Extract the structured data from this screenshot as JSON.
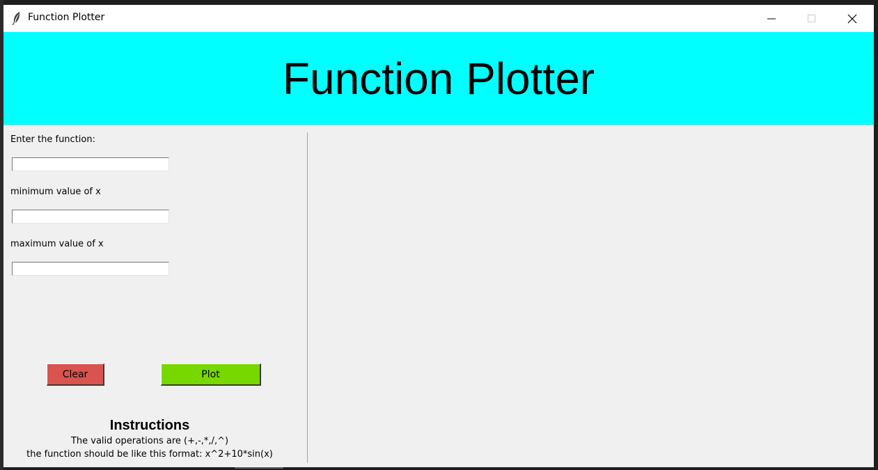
{
  "window": {
    "title": "Function Plotter",
    "app_icon": "feather-icon",
    "controls": [
      "minimize-icon",
      "maximize-icon",
      "close-icon"
    ]
  },
  "banner": {
    "title": "Function Plotter",
    "background": "#00ffff"
  },
  "form": {
    "function_label": "Enter the function:",
    "function_value": "",
    "min_label": "minimum value of x",
    "min_value": "",
    "max_label": "maximum value of x",
    "max_value": ""
  },
  "buttons": {
    "clear_label": "Clear",
    "clear_color": "#d9534f",
    "plot_label": "Plot",
    "plot_color": "#77d800"
  },
  "instructions": {
    "title": "Instructions",
    "line1": "The valid operations are (+,-,*,/,^)",
    "line2": "the function should be like this format: x^2+10*sin(x)"
  }
}
